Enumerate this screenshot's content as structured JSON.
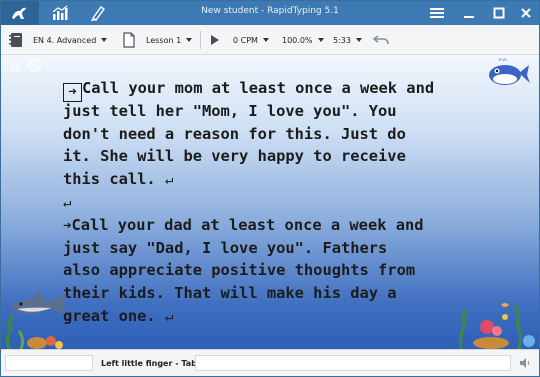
{
  "app": {
    "title": "New student - RapidTyping  5.1"
  },
  "titlebar": {
    "icons": [
      "kangaroo-logo-icon",
      "statistics-icon",
      "lesson-editor-icon"
    ],
    "window_buttons": [
      "hamburger-menu-icon",
      "minimize-icon",
      "maximize-icon",
      "close-icon"
    ]
  },
  "toolbar": {
    "course": "EN 4. Advanced",
    "lesson": "Lesson 1",
    "speed": "0 CPM",
    "zoom": "100.0%",
    "time": "5:33"
  },
  "lesson_text": {
    "paragraph1": [
      "Call your mom at least once a week and",
      "just tell her \"Mom, I love you\". You",
      "don't need a reason for this. Just do",
      "it. She will be very happy to receive",
      "this call."
    ],
    "paragraph2": [
      "Call your dad at least once a week and",
      "just say \"Dad, I love you\". Fathers",
      "also appreciate positive thoughts from",
      "their kids. That will make his day a",
      "great one."
    ],
    "tab_symbol": "➜",
    "enter_symbol": "↵"
  },
  "status": {
    "finger_hint": "Left little finger - Tab"
  }
}
